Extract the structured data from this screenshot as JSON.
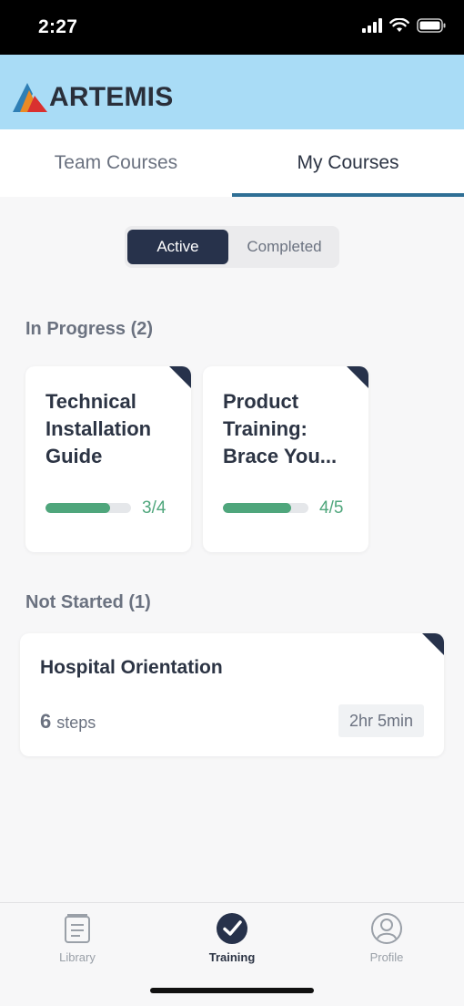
{
  "status_bar": {
    "time": "2:27"
  },
  "header": {
    "logo_text": "ARTEMIS"
  },
  "tabs": [
    {
      "label": "Team Courses",
      "active": false
    },
    {
      "label": "My Courses",
      "active": true
    }
  ],
  "filter": {
    "active_label": "Active",
    "completed_label": "Completed",
    "selected": "Active"
  },
  "in_progress": {
    "title": "In Progress (2)",
    "courses": [
      {
        "title": "Technical Installation Guide",
        "progress_text": "3/4",
        "progress": 0.75
      },
      {
        "title": "Product Training: Brace You...",
        "progress_text": "4/5",
        "progress": 0.8
      }
    ]
  },
  "not_started": {
    "title": "Not Started (1)",
    "courses": [
      {
        "title": "Hospital Orientation",
        "steps_count": "6",
        "steps_label": "steps",
        "duration": "2hr 5min"
      }
    ]
  },
  "bottom_nav": [
    {
      "label": "Library",
      "icon": "library-icon",
      "active": false
    },
    {
      "label": "Training",
      "icon": "checkmark-circle-icon",
      "active": true
    },
    {
      "label": "Profile",
      "icon": "profile-icon",
      "active": false
    }
  ],
  "colors": {
    "header": "#a9dcf6",
    "accent": "#27324b",
    "progress": "#4fa67c",
    "tab_underline": "#2f6f95"
  }
}
